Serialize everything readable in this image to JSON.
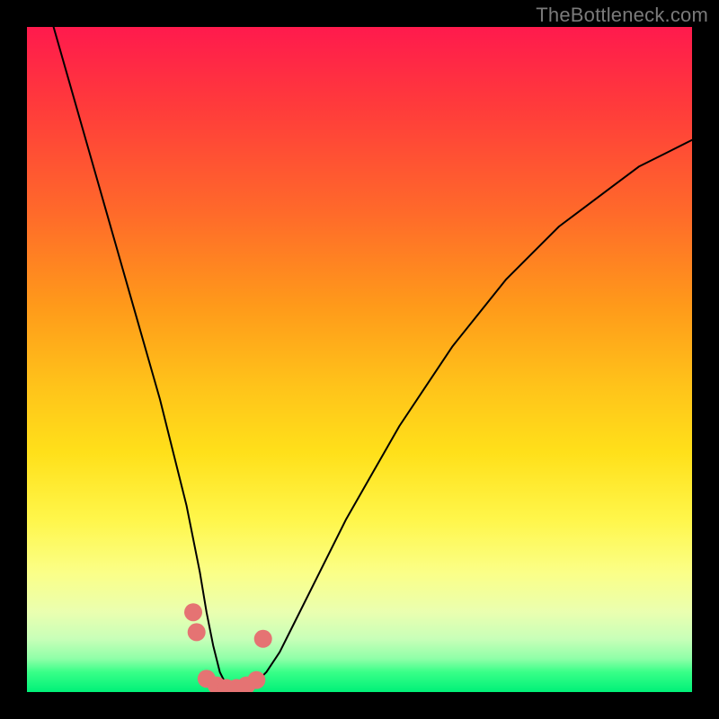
{
  "watermark": "TheBottleneck.com",
  "chart_data": {
    "type": "line",
    "title": "",
    "xlabel": "",
    "ylabel": "",
    "xlim": [
      0,
      100
    ],
    "ylim": [
      0,
      100
    ],
    "grid": false,
    "series": [
      {
        "name": "curve",
        "x": [
          4,
          6,
          8,
          10,
          12,
          14,
          16,
          18,
          20,
          22,
          24,
          26,
          27,
          28,
          29,
          30,
          31,
          32,
          34,
          36,
          38,
          40,
          44,
          48,
          52,
          56,
          60,
          64,
          68,
          72,
          76,
          80,
          84,
          88,
          92,
          96,
          100
        ],
        "values": [
          100,
          93,
          86,
          79,
          72,
          65,
          58,
          51,
          44,
          36,
          28,
          18,
          12,
          7,
          3,
          1,
          0,
          0,
          1,
          3,
          6,
          10,
          18,
          26,
          33,
          40,
          46,
          52,
          57,
          62,
          66,
          70,
          73,
          76,
          79,
          81,
          83
        ]
      }
    ],
    "markers": [
      {
        "x": 25.0,
        "y": 12
      },
      {
        "x": 25.5,
        "y": 9
      },
      {
        "x": 27.0,
        "y": 2
      },
      {
        "x": 28.5,
        "y": 1
      },
      {
        "x": 30.0,
        "y": 0.6
      },
      {
        "x": 31.5,
        "y": 0.6
      },
      {
        "x": 33.0,
        "y": 1.0
      },
      {
        "x": 34.5,
        "y": 1.8
      },
      {
        "x": 35.5,
        "y": 8
      }
    ],
    "marker_color": "#e57373",
    "line_color": "#000000"
  },
  "colors": {
    "frame": "#000000",
    "gradient_top": "#ff1a4d",
    "gradient_bottom": "#00f078"
  }
}
